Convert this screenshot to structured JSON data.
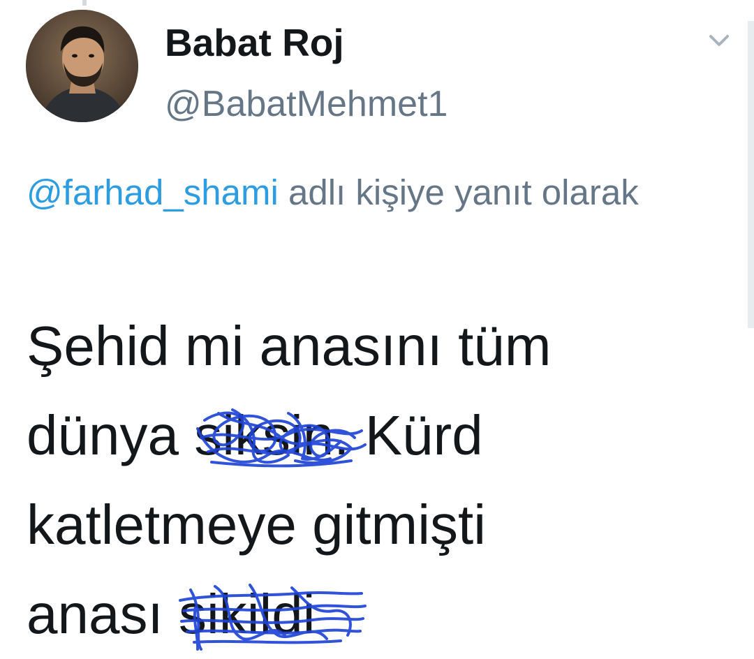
{
  "tweet": {
    "display_name": "Babat Roj",
    "username": "@BabatMehmet1",
    "reply_handle": "@farhad_shami",
    "reply_suffix": " adlı kişiye yanıt olarak",
    "text": {
      "line1": "Şehid mi anasını tüm",
      "line2_before": "dünya ",
      "line2_redacted": "siksin",
      "line2_after": ". Kürd",
      "line3": "katletmeye gitmişti",
      "line4_before": "anası ",
      "line4_redacted": "sikildi"
    }
  },
  "icons": {
    "menu": "chevron-down-icon",
    "avatar": "profile-photo"
  },
  "colors": {
    "name": "#14171a",
    "secondary": "#657786",
    "link": "#2b9de0",
    "scribble": "#1f45d6"
  }
}
